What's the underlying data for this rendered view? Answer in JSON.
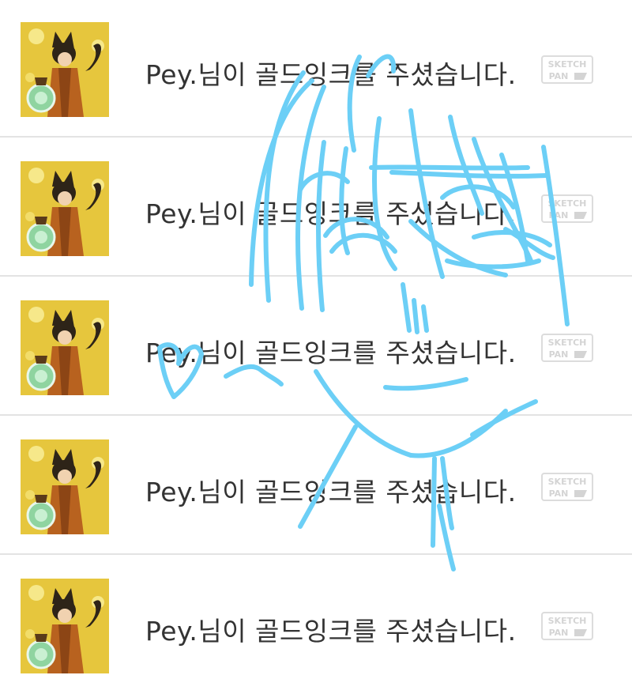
{
  "notifications": [
    {
      "message": "Pey.님이 골드잉크를 주셨습니다.",
      "badge_top": "SKETCH",
      "badge_bottom": "PAN",
      "avatar_icon": "cat-eared-character-avatar"
    },
    {
      "message": "Pey.님이 골드잉크를 주셨습니다.",
      "badge_top": "SKETCH",
      "badge_bottom": "PAN",
      "avatar_icon": "cat-eared-character-avatar"
    },
    {
      "message": "Pey.님이 골드잉크를 주셨습니다.",
      "badge_top": "SKETCH",
      "badge_bottom": "PAN",
      "avatar_icon": "cat-eared-character-avatar"
    },
    {
      "message": "Pey.님이 골드잉크를 주셨습니다.",
      "badge_top": "SKETCH",
      "badge_bottom": "PAN",
      "avatar_icon": "cat-eared-character-avatar"
    },
    {
      "message": "Pey.님이 골드잉크를 주셨습니다.",
      "badge_top": "SKETCH",
      "badge_bottom": "PAN",
      "avatar_icon": "cat-eared-character-avatar"
    }
  ],
  "colors": {
    "sketch_stroke": "#6ccff6",
    "divider": "#e3e3e3",
    "message_text": "#333333",
    "badge": "#d8d8d8",
    "avatar_background": "#e9c53a"
  }
}
